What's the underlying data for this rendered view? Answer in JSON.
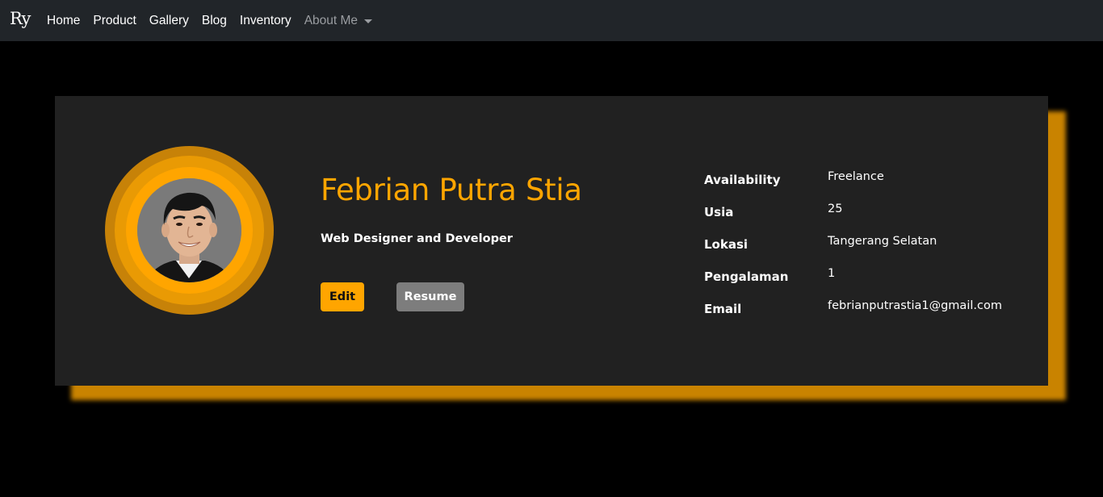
{
  "navbar": {
    "brand": "Ry",
    "links": [
      "Home",
      "Product",
      "Gallery",
      "Blog",
      "Inventory"
    ],
    "dropdown_label": "About Me"
  },
  "profile": {
    "name": "Febrian Putra Stia",
    "role": "Web Designer and Developer",
    "edit_label": "Edit",
    "resume_label": "Resume",
    "photo_alt": "profile-photo"
  },
  "info": [
    {
      "label": "Availability",
      "value": "Freelance"
    },
    {
      "label": "Usia",
      "value": "25"
    },
    {
      "label": "Lokasi",
      "value": "Tangerang Selatan"
    },
    {
      "label": "Pengalaman",
      "value": "1"
    },
    {
      "label": "Email",
      "value": "febrianputrastia1@gmail.com"
    }
  ],
  "colors": {
    "accent": "#ffa500",
    "navbar_bg": "#212529",
    "card_bg": "#212121",
    "page_bg": "#000000",
    "resume_button": "#7d7d7d"
  }
}
